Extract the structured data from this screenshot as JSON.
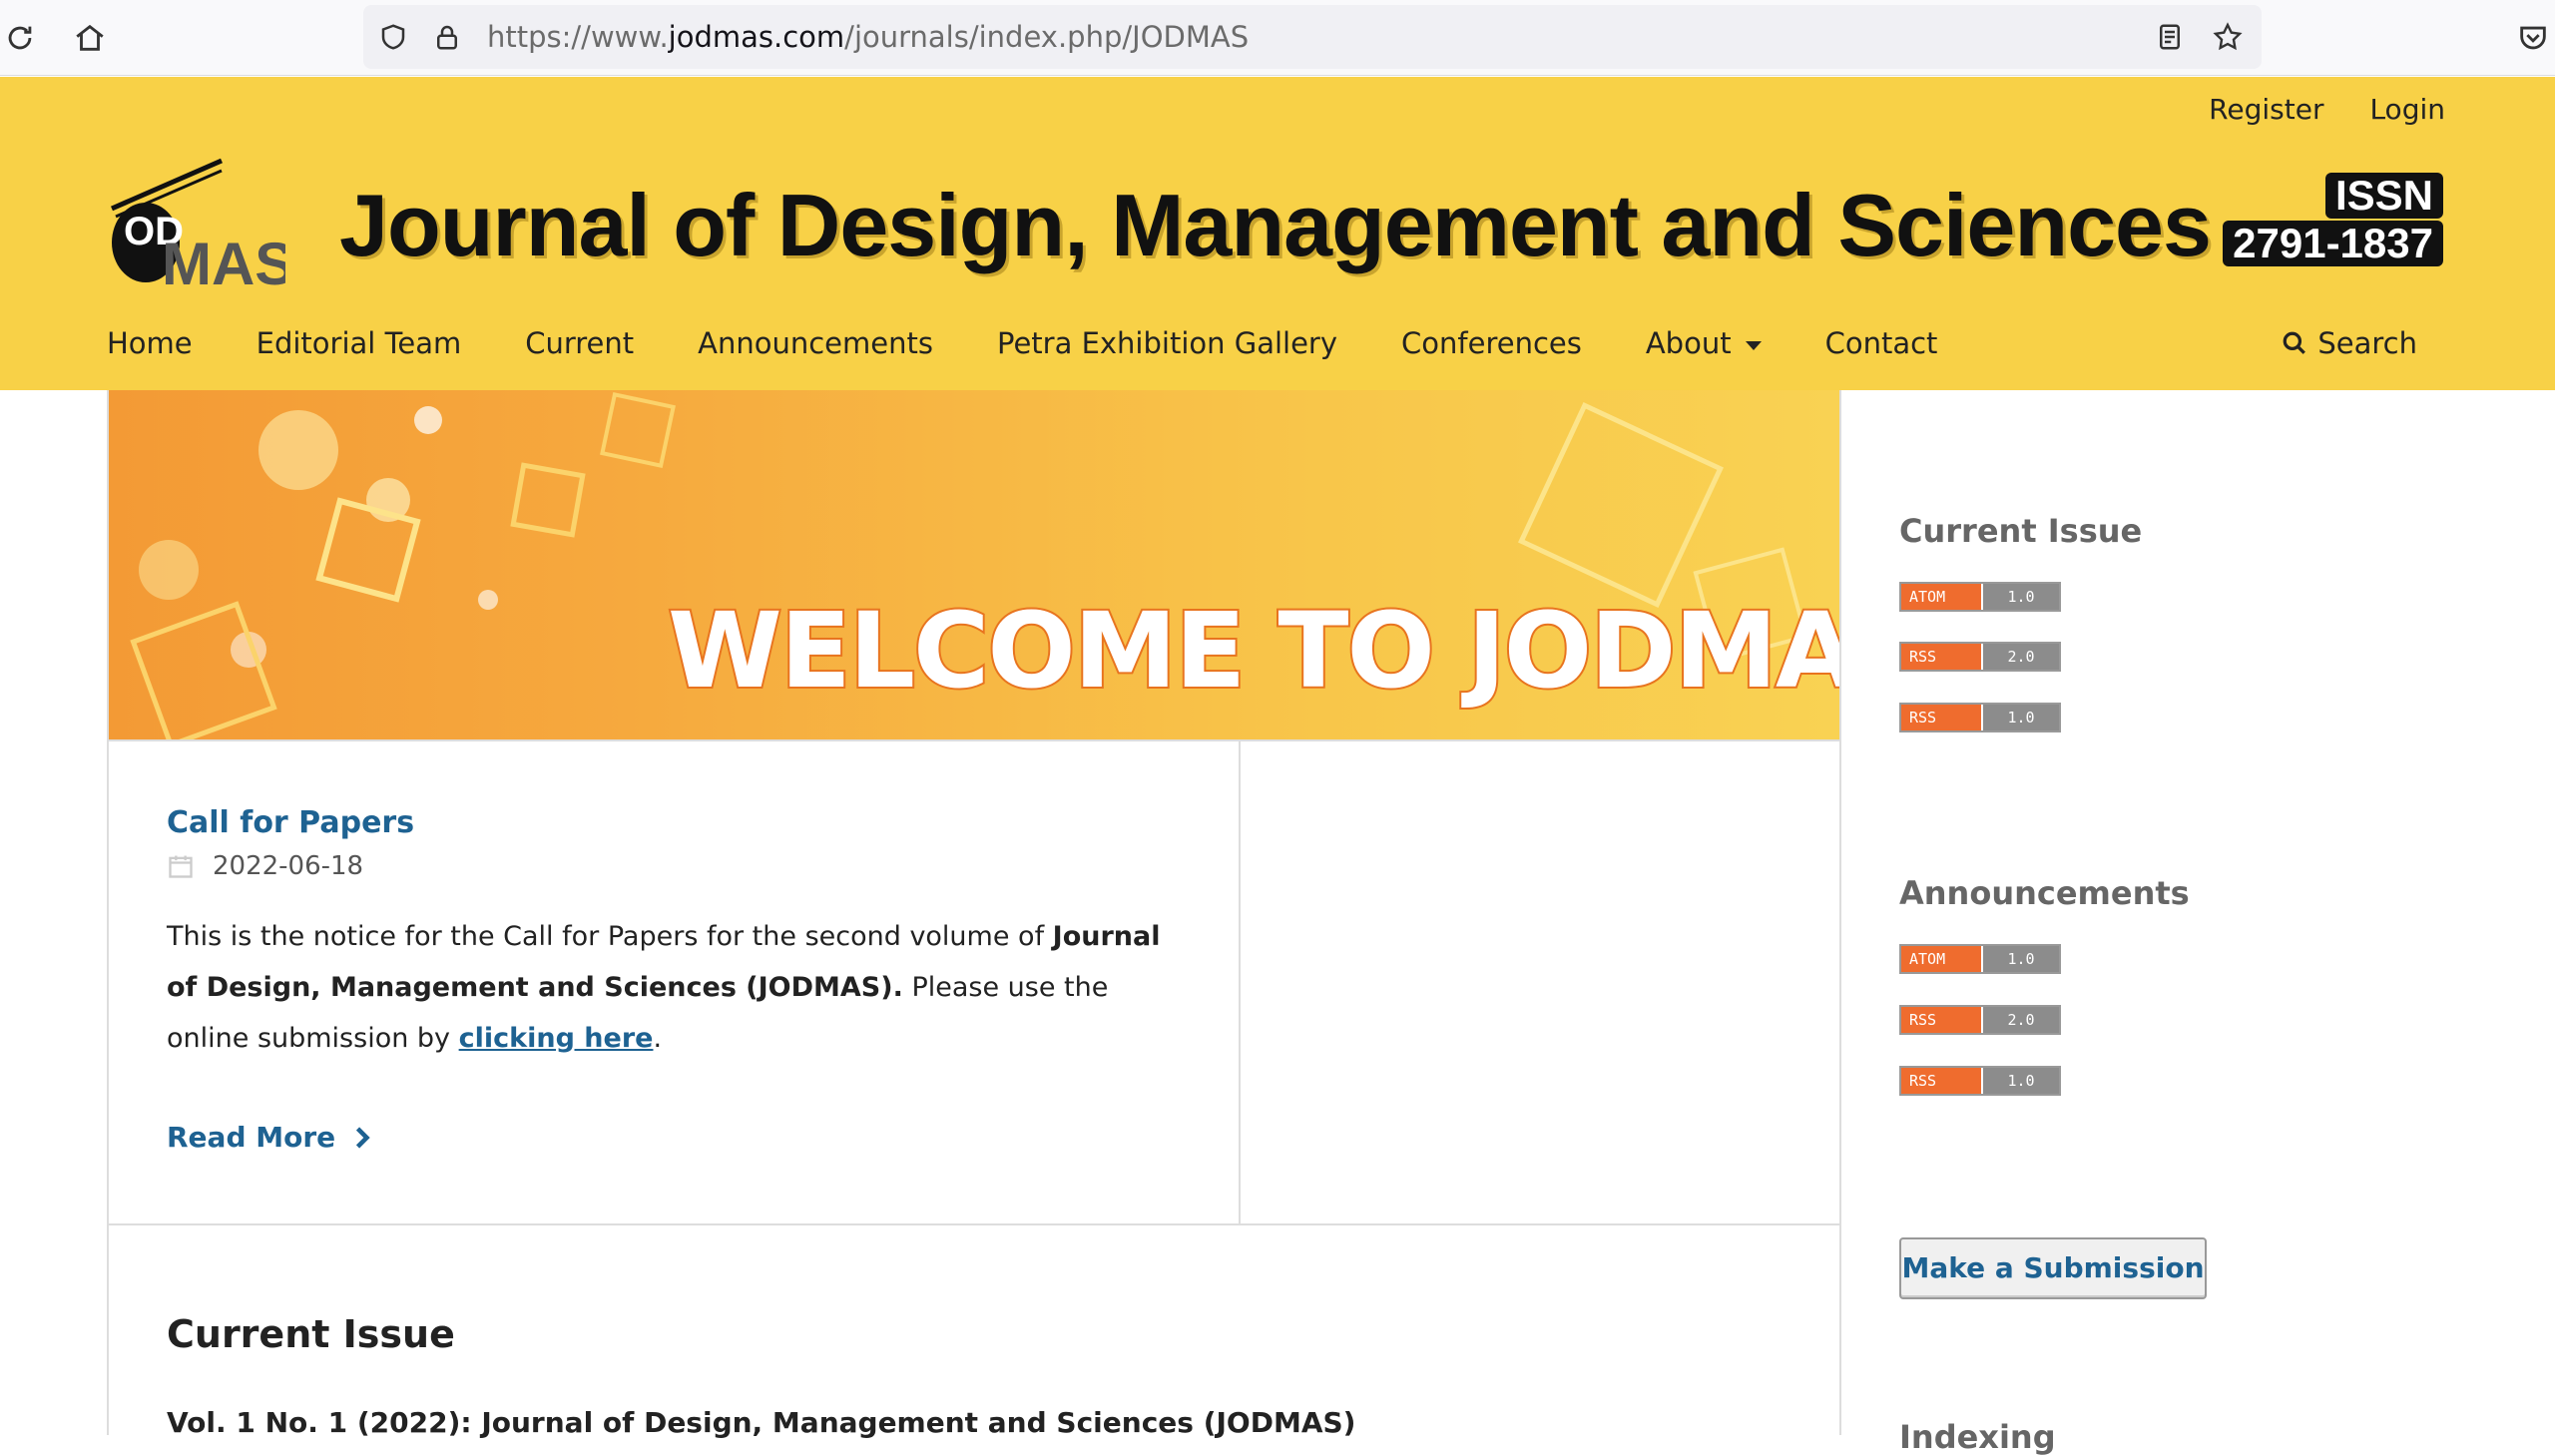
{
  "browser": {
    "url_prefix": "https://www.",
    "url_domain": "jodmas.com",
    "url_path": "/journals/index.php/JODMAS"
  },
  "header": {
    "user_nav": [
      "Register",
      "Login"
    ],
    "logo_text": "ODMAS",
    "title": "Journal of Design, Management and Sciences",
    "issn_label": "ISSN",
    "issn_number": "2791-1837",
    "nav": [
      "Home",
      "Editorial Team",
      "Current",
      "Announcements",
      "Petra Exhibition Gallery",
      "Conferences",
      "About",
      "Contact"
    ],
    "search_label": "Search"
  },
  "hero": {
    "text": "WELCOME TO JODMAS"
  },
  "announcement": {
    "title": "Call for Papers",
    "date": "2022-06-18",
    "body_1": "This is the notice for the Call for Papers for the second volume of ",
    "body_bold": "Journal of Design, Management and Sciences (JODMAS).",
    "body_2": " Please use the online submission by ",
    "link": "clicking here",
    "body_3": ".",
    "read_more": "Read More"
  },
  "current_issue": {
    "heading": "Current Issue",
    "volume": "Vol. 1 No. 1 (2022): Journal of Design, Management and Sciences (JODMAS)"
  },
  "sidebar": {
    "current_issue_heading": "Current Issue",
    "announcements_heading": "Announcements",
    "feeds": [
      {
        "key": "ATOM",
        "ver": "1.0"
      },
      {
        "key": "RSS",
        "ver": "2.0"
      },
      {
        "key": "RSS",
        "ver": "1.0"
      }
    ],
    "submit_label": "Make a Submission",
    "indexing_heading": "Indexing"
  },
  "colors": {
    "header": "#f8d147",
    "link": "#1e6292",
    "feed": "#ef6c2e"
  }
}
